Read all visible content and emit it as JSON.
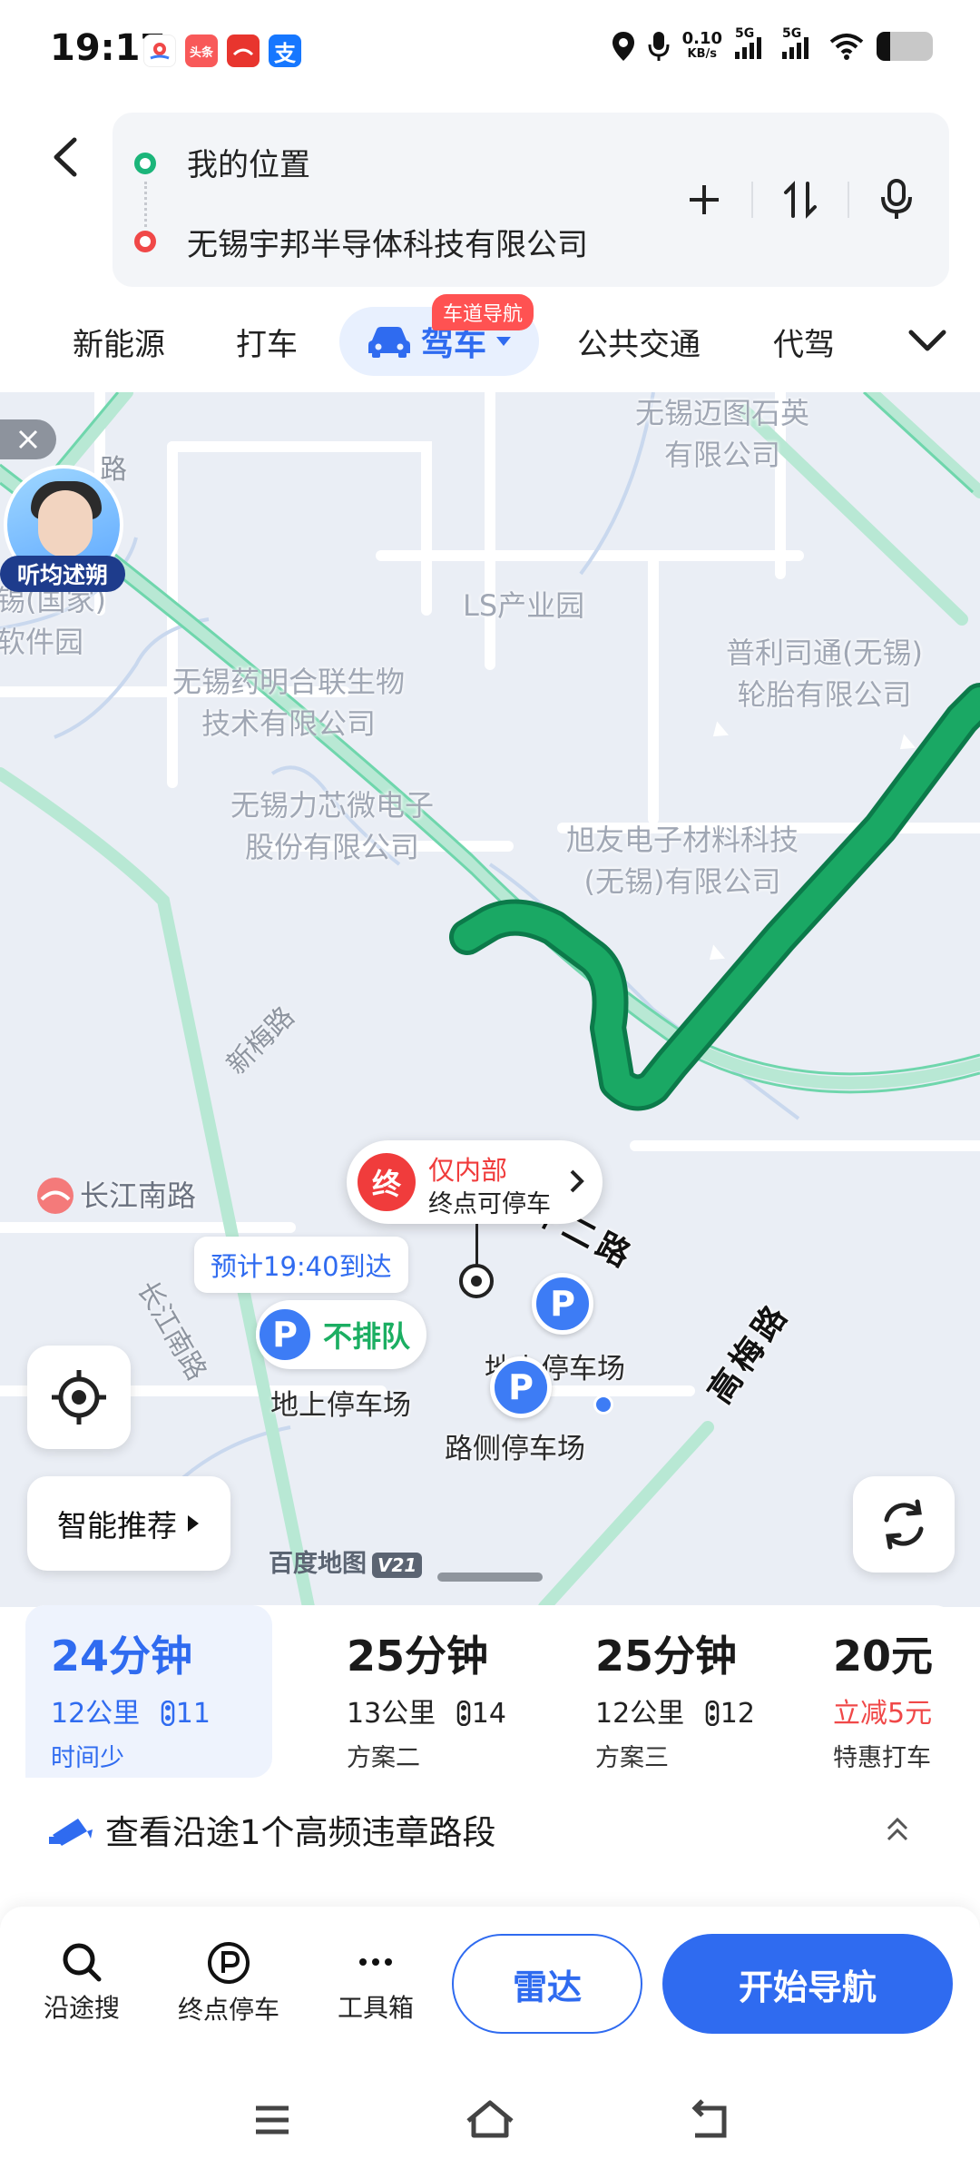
{
  "status_bar": {
    "time": "19:17",
    "apps": [
      {
        "icon": "maps-app-icon",
        "text": "",
        "color": "#ffffff"
      },
      {
        "icon": "toutiao-app-icon",
        "text": "头条",
        "color": "#f85959"
      },
      {
        "icon": "shop-app-icon",
        "text": "",
        "color": "#e8352e"
      },
      {
        "icon": "alipay-app-icon",
        "text": "支",
        "color": "#1677ff"
      }
    ],
    "net_speed_value": "0.10",
    "net_speed_unit": "KB/s",
    "signal1_label": "5G",
    "signal2_label": "5G",
    "battery_level": 0.24
  },
  "route_input": {
    "start": "我的位置",
    "end": "无锡宇邦半导体科技有限公司"
  },
  "mode_tabs": {
    "items": [
      "新能源",
      "打车"
    ],
    "active": "驾车",
    "active_badge": "车道导航",
    "items_after": [
      "公共交通",
      "代驾"
    ]
  },
  "map": {
    "labels": [
      {
        "text": "无锡迈图石英\n有限公司"
      },
      {
        "text": "LS产业园"
      },
      {
        "text": "普利司通(无锡)\n轮胎有限公司"
      },
      {
        "text": "无锡药明合联生物\n技术有限公司"
      },
      {
        "text": "无锡力芯微电子\n股份有限公司"
      },
      {
        "text": "旭友电子材料科技\n(无锡)有限公司"
      },
      {
        "text": "锡(国家)\n软件园"
      },
      {
        "text": "长江南路"
      }
    ],
    "partial_road": "路",
    "road_labels": [
      "新梅路",
      "长江南路",
      "内环二路",
      "高梅路"
    ],
    "ad_label": "听均述朔",
    "destination_line1": "仅内部",
    "destination_line2": "终点可停车",
    "destination_icon": "终",
    "eta": "预计19:40到达",
    "parking_tag": "不排队",
    "parking_icon": "P",
    "parking_lot1": "地上停车场",
    "parking_lot2": "地上停车场",
    "parking_lot3": "路侧停车场",
    "smart_recommend": "智能推荐",
    "logo": "百度地图",
    "logo_version": "V21",
    "route_color": "#1aa864"
  },
  "routes": [
    {
      "time": "24分钟",
      "distance": "12公里",
      "lights": "11",
      "sub": "时间少"
    },
    {
      "time": "25分钟",
      "distance": "13公里",
      "lights": "14",
      "sub": "方案二"
    },
    {
      "time": "25分钟",
      "distance": "12公里",
      "lights": "12",
      "sub": "方案三"
    },
    {
      "time": "20元",
      "promo": "立减5元",
      "sub": "特惠打车"
    }
  ],
  "violation_notice": "查看沿途1个高频违章路段",
  "bottom_bar": {
    "tools": [
      "沿途搜",
      "终点停车",
      "工具箱"
    ],
    "radar": "雷达",
    "start_nav": "开始导航"
  }
}
